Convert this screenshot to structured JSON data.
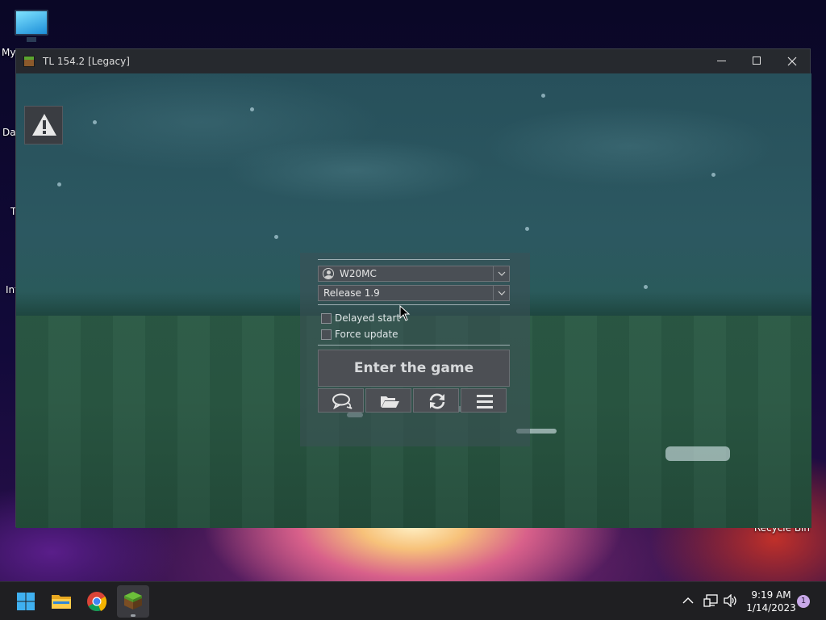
{
  "desktop": {
    "icons": [
      {
        "label": "My"
      },
      {
        "label": "Dat"
      },
      {
        "label": "T"
      },
      {
        "label": "Inf"
      }
    ],
    "recycle_bin_label": "Recycle Bin"
  },
  "window": {
    "title": "TL 154.2 [Legacy]",
    "controls": [
      "minimize-icon",
      "maximize-icon",
      "close-icon"
    ]
  },
  "launcher": {
    "alert_icon": "warning-icon",
    "account": {
      "selected": "W20MC"
    },
    "version": {
      "selected": "Release 1.9"
    },
    "options": [
      {
        "label": "Delayed start",
        "checked": false
      },
      {
        "label": "Force update",
        "checked": false
      }
    ],
    "enter_button": "Enter the game",
    "tools": [
      "chat-icon",
      "folder-icon",
      "refresh-icon",
      "menu-icon"
    ]
  },
  "taskbar": {
    "apps": [
      "windows-start-icon",
      "file-explorer-icon",
      "chrome-icon",
      "tlauncher-icon"
    ],
    "tray": [
      "chevron-up-icon",
      "network-icon",
      "volume-icon"
    ],
    "time": "9:19 AM",
    "date": "1/14/2023",
    "notification_count": "1"
  }
}
